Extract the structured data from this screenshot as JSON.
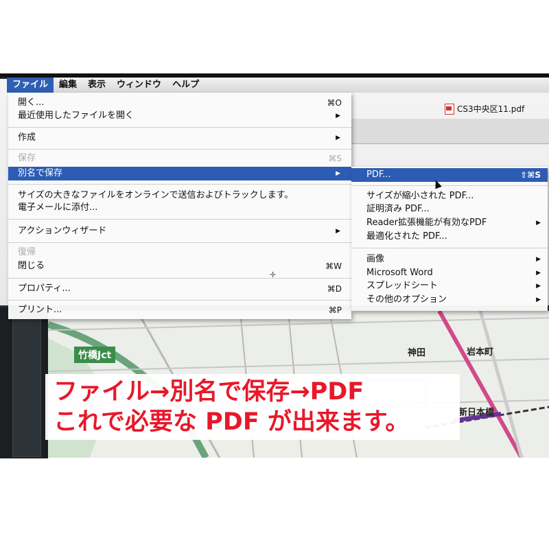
{
  "menubar": {
    "items": [
      "ファイル",
      "編集",
      "表示",
      "ウィンドウ",
      "ヘルプ"
    ],
    "active_index": 0
  },
  "document_tab": {
    "title": "CS3中央区11.pdf",
    "icon": "pdf-file-icon"
  },
  "file_menu": {
    "open": {
      "label": "開く...",
      "shortcut": "⌘O"
    },
    "open_recent": {
      "label": "最近使用したファイルを開く"
    },
    "create": {
      "label": "作成"
    },
    "save": {
      "label": "保存",
      "shortcut": "⌘S"
    },
    "save_as": {
      "label": "別名で保存"
    },
    "send_large": {
      "label": "サイズの大きなファイルをオンラインで送信およびトラックします。"
    },
    "email_attach": {
      "label": "電子メールに添付..."
    },
    "action_wizard": {
      "label": "アクションウィザード"
    },
    "revert": {
      "label": "復帰"
    },
    "close": {
      "label": "閉じる",
      "shortcut": "⌘W"
    },
    "properties": {
      "label": "プロパティ...",
      "shortcut": "⌘D"
    },
    "print": {
      "label": "プリント...",
      "shortcut": "⌘P"
    }
  },
  "save_as_submenu": {
    "pdf": {
      "label": "PDF...",
      "shortcut": "⇧⌘S"
    },
    "reduced": {
      "label": "サイズが縮小された PDF..."
    },
    "certified": {
      "label": "証明済み PDF..."
    },
    "reader_ext": {
      "label": "Reader拡張機能が有効なPDF"
    },
    "optimized": {
      "label": "最適化された PDF..."
    },
    "image": {
      "label": "画像"
    },
    "word": {
      "label": "Microsoft Word"
    },
    "spreadsheet": {
      "label": "スプレッドシート"
    },
    "other": {
      "label": "その他のオプション"
    }
  },
  "map": {
    "jct_label": "竹橋Jct",
    "labels": [
      "神田",
      "岩本町",
      "新日本橋"
    ]
  },
  "caption": {
    "line1": "ファイル→別名で保存→PDF",
    "line2": "これで必要な PDF が出来ます。"
  },
  "colors": {
    "highlight": "#2c5cb4",
    "caption": "#e8182a"
  }
}
